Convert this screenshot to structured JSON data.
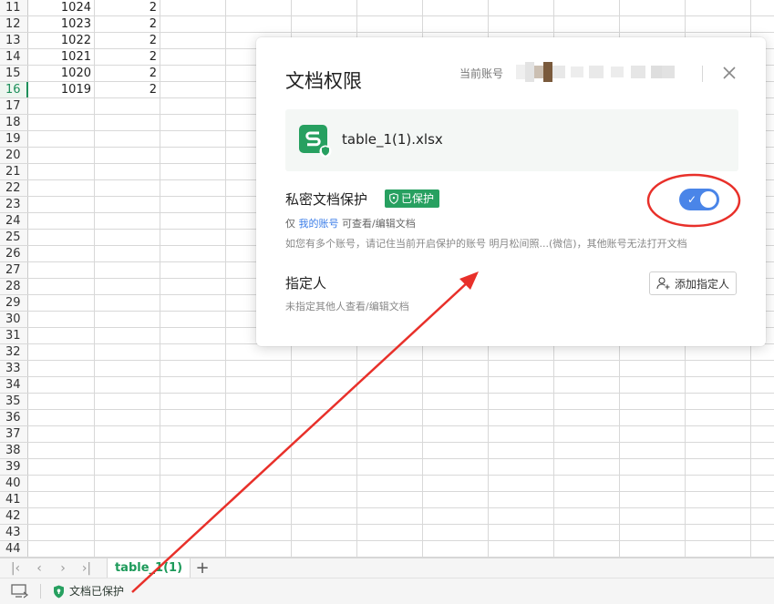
{
  "spreadsheet": {
    "rows": [
      {
        "num": "11",
        "a": "1024",
        "b": "2"
      },
      {
        "num": "12",
        "a": "1023",
        "b": "2"
      },
      {
        "num": "13",
        "a": "1022",
        "b": "2"
      },
      {
        "num": "14",
        "a": "1021",
        "b": "2"
      },
      {
        "num": "15",
        "a": "1020",
        "b": "2"
      },
      {
        "num": "16",
        "a": "1019",
        "b": "2"
      },
      {
        "num": "17"
      },
      {
        "num": "18"
      },
      {
        "num": "19"
      },
      {
        "num": "20"
      },
      {
        "num": "21"
      },
      {
        "num": "22"
      },
      {
        "num": "23"
      },
      {
        "num": "24"
      },
      {
        "num": "25"
      },
      {
        "num": "26"
      },
      {
        "num": "27"
      },
      {
        "num": "28"
      },
      {
        "num": "29"
      },
      {
        "num": "30"
      },
      {
        "num": "31"
      },
      {
        "num": "32"
      },
      {
        "num": "33"
      },
      {
        "num": "34"
      },
      {
        "num": "35"
      },
      {
        "num": "36"
      },
      {
        "num": "37"
      },
      {
        "num": "38"
      },
      {
        "num": "39"
      },
      {
        "num": "40"
      },
      {
        "num": "41"
      },
      {
        "num": "42"
      },
      {
        "num": "43"
      },
      {
        "num": "44"
      }
    ],
    "active_row": "16"
  },
  "sheet_bar": {
    "tab_label": "table_1(1)",
    "add_label": "+",
    "nav": [
      "first-sheet-icon",
      "prev-sheet-icon",
      "next-sheet-icon",
      "last-sheet-icon"
    ]
  },
  "status_bar": {
    "protect_label": "文档已保护"
  },
  "dialog": {
    "title": "文档权限",
    "account_label": "当前账号",
    "file": {
      "name": "table_1(1).xlsx"
    },
    "private_protection": {
      "title": "私密文档保护",
      "badge": "已保护",
      "line1_prefix": "仅",
      "line1_link": "我的账号",
      "line1_suffix": "可查看/编辑文档",
      "line2": "如您有多个账号，请记住当前开启保护的账号 明月松间照...(微信)，其他账号无法打开文档",
      "enabled": true
    },
    "designee": {
      "title": "指定人",
      "subtitle": "未指定其他人查看/编辑文档",
      "add_button": "添加指定人"
    }
  },
  "colors": {
    "accent_green": "#27a060",
    "toggle_blue": "#4a85e8",
    "annotation_red": "#e8302a",
    "link_blue": "#3b7de8"
  }
}
